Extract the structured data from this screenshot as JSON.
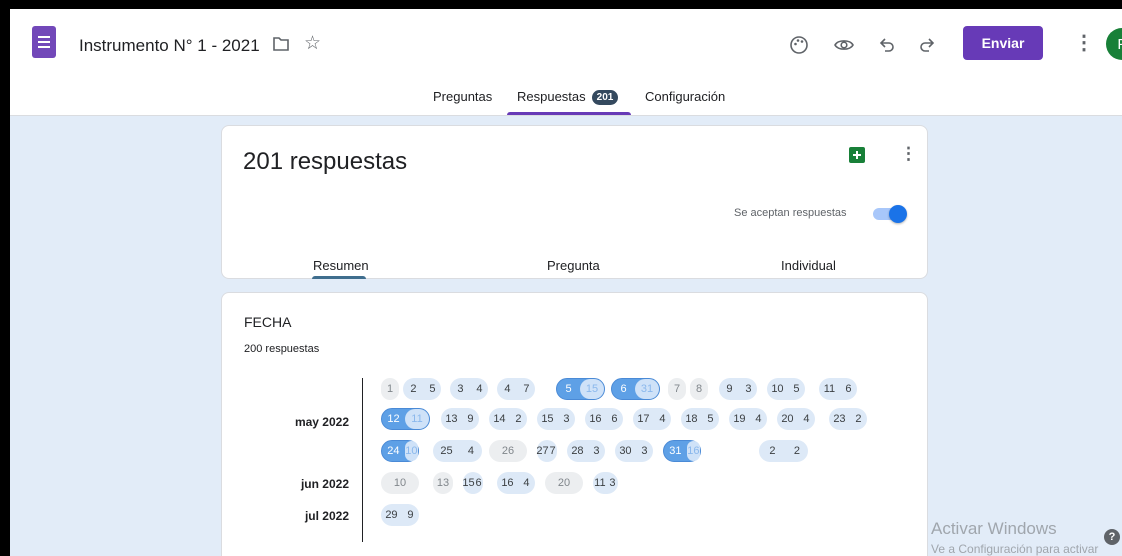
{
  "header": {
    "title": "Instrumento N° 1 - 2021",
    "send_label": "Enviar",
    "avatar_letter": "F"
  },
  "tabs": {
    "questions": "Preguntas",
    "responses": "Respuestas",
    "responses_count": "201",
    "settings": "Configuración"
  },
  "summary": {
    "title": "201 respuestas",
    "accepting_label": "Se aceptan respuestas",
    "accepting": true,
    "subtabs": [
      "Resumen",
      "Pregunta",
      "Individual"
    ]
  },
  "question": {
    "title": "FECHA",
    "count_label": "200 respuestas",
    "months": [
      "may 2022",
      "jun 2022",
      "jul 2022"
    ],
    "dates": [
      {
        "day": "1",
        "count": "",
        "style": "grey"
      },
      {
        "day": "2",
        "count": "5",
        "style": "light"
      },
      {
        "day": "3",
        "count": "4",
        "style": "light"
      },
      {
        "day": "4",
        "count": "7",
        "style": "light"
      },
      {
        "day": "5",
        "count": "15",
        "style": "dark"
      },
      {
        "day": "6",
        "count": "31",
        "style": "dark"
      },
      {
        "day": "7",
        "count": "",
        "style": "grey"
      },
      {
        "day": "8",
        "count": "",
        "style": "grey"
      },
      {
        "day": "9",
        "count": "3",
        "style": "light"
      },
      {
        "day": "10",
        "count": "5",
        "style": "light"
      },
      {
        "day": "11",
        "count": "6",
        "style": "light"
      },
      {
        "day": "12",
        "count": "11",
        "style": "dark"
      },
      {
        "day": "13",
        "count": "9",
        "style": "light"
      },
      {
        "day": "14",
        "count": "2",
        "style": "light"
      },
      {
        "day": "15",
        "count": "3",
        "style": "light"
      },
      {
        "day": "16",
        "count": "6",
        "style": "light"
      },
      {
        "day": "17",
        "count": "4",
        "style": "light"
      },
      {
        "day": "18",
        "count": "5",
        "style": "light"
      },
      {
        "day": "19",
        "count": "4",
        "style": "light"
      },
      {
        "day": "20",
        "count": "4",
        "style": "light"
      },
      {
        "day": "23",
        "count": "2",
        "style": "light"
      },
      {
        "day": "24",
        "count": "10",
        "style": "dark"
      },
      {
        "day": "25",
        "count": "4",
        "style": "light"
      },
      {
        "day": "26",
        "count": "",
        "style": "grey"
      },
      {
        "day": "27",
        "count": "7",
        "style": "light"
      },
      {
        "day": "28",
        "count": "3",
        "style": "light"
      },
      {
        "day": "30",
        "count": "3",
        "style": "light"
      },
      {
        "day": "31",
        "count": "16",
        "style": "dark"
      },
      {
        "day": "2",
        "count": "2",
        "style": "light"
      },
      {
        "day": "10",
        "count": "",
        "style": "grey"
      },
      {
        "day": "13",
        "count": "",
        "style": "grey"
      },
      {
        "day": "15",
        "count": "6",
        "style": "light"
      },
      {
        "day": "16",
        "count": "4",
        "style": "light"
      },
      {
        "day": "20",
        "count": "",
        "style": "grey"
      },
      {
        "day": "11",
        "count": "3",
        "style": "light"
      },
      {
        "day": "29",
        "count": "9",
        "style": "light"
      }
    ]
  },
  "watermark": {
    "line1": "Activar Windows",
    "line2": "Ve a Configuración para activar Windows."
  }
}
